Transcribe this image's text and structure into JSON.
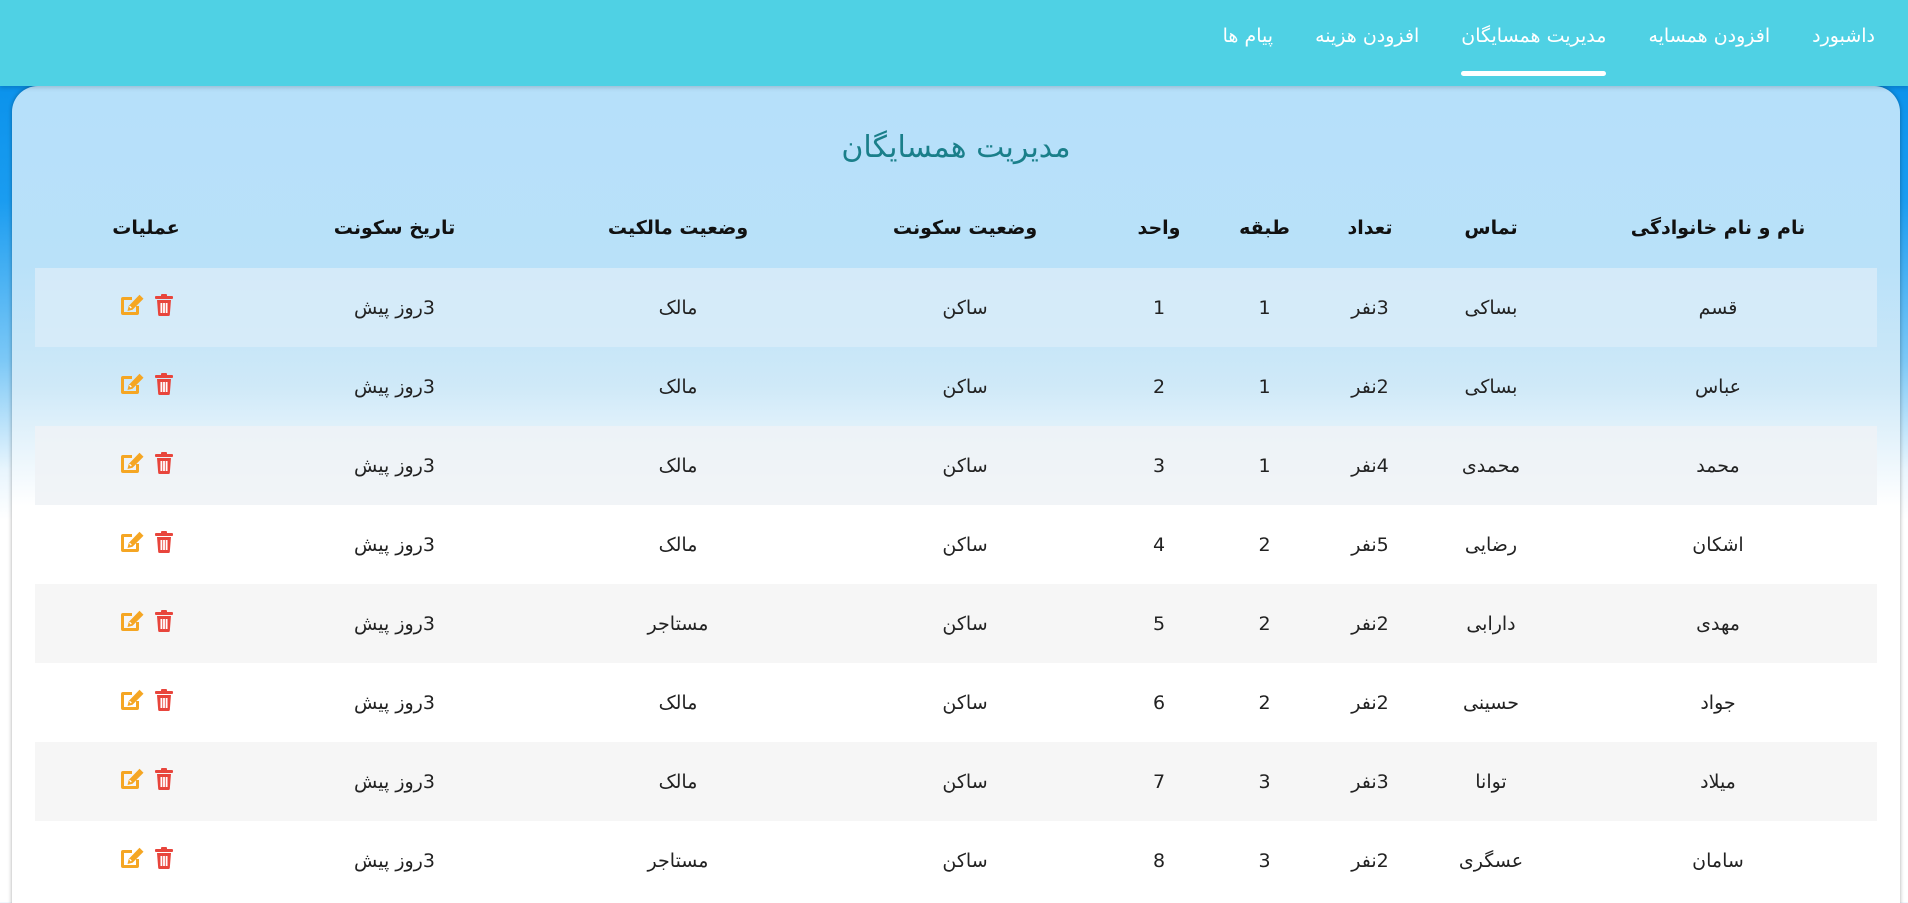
{
  "nav": {
    "items": [
      {
        "label": "داشبورد"
      },
      {
        "label": "افزودن همسایه"
      },
      {
        "label": "مدیریت همسایگان",
        "active": true
      },
      {
        "label": "افزودن هزینه"
      },
      {
        "label": "پیام ها"
      }
    ]
  },
  "page": {
    "title": "مدیریت همسایگان"
  },
  "table": {
    "headers": {
      "name": "نام و نام خانوادگی",
      "contact": "تماس",
      "count": "تعداد",
      "floor": "طبقه",
      "unit": "واحد",
      "residence_status": "وضعیت سکونت",
      "ownership_status": "وضعیت مالکیت",
      "residence_date": "تاریخ سکونت",
      "operations": "عملیات"
    },
    "rows": [
      {
        "name": "قسم",
        "contact": "بساکی",
        "count": "3نفر",
        "floor": "1",
        "unit": "1",
        "residence_status": "ساکن",
        "ownership_status": "مالک",
        "residence_date": "3روز پیش"
      },
      {
        "name": "عباس",
        "contact": "بساکی",
        "count": "2نفر",
        "floor": "1",
        "unit": "2",
        "residence_status": "ساکن",
        "ownership_status": "مالک",
        "residence_date": "3روز پیش"
      },
      {
        "name": "محمد",
        "contact": "محمدی",
        "count": "4نفر",
        "floor": "1",
        "unit": "3",
        "residence_status": "ساکن",
        "ownership_status": "مالک",
        "residence_date": "3روز پیش"
      },
      {
        "name": "اشکان",
        "contact": "رضایی",
        "count": "5نفر",
        "floor": "2",
        "unit": "4",
        "residence_status": "ساکن",
        "ownership_status": "مالک",
        "residence_date": "3روز پیش"
      },
      {
        "name": "مهدی",
        "contact": "دارابی",
        "count": "2نفر",
        "floor": "2",
        "unit": "5",
        "residence_status": "ساکن",
        "ownership_status": "مستاجر",
        "residence_date": "3روز پیش"
      },
      {
        "name": "جواد",
        "contact": "حسینی",
        "count": "2نفر",
        "floor": "2",
        "unit": "6",
        "residence_status": "ساکن",
        "ownership_status": "مالک",
        "residence_date": "3روز پیش"
      },
      {
        "name": "میلاد",
        "contact": "توانا",
        "count": "3نفر",
        "floor": "3",
        "unit": "7",
        "residence_status": "ساکن",
        "ownership_status": "مالک",
        "residence_date": "3روز پیش"
      },
      {
        "name": "سامان",
        "contact": "عسگری",
        "count": "2نفر",
        "floor": "3",
        "unit": "8",
        "residence_status": "ساکن",
        "ownership_status": "مستاجر",
        "residence_date": "3روز پیش"
      }
    ]
  },
  "icons": {
    "edit": "edit-icon",
    "delete": "trash-icon"
  },
  "colors": {
    "topbar": "#4fd1e4",
    "title": "#1a7f8a",
    "edit_icon": "#f5a623",
    "delete_icon": "#e8453c"
  }
}
